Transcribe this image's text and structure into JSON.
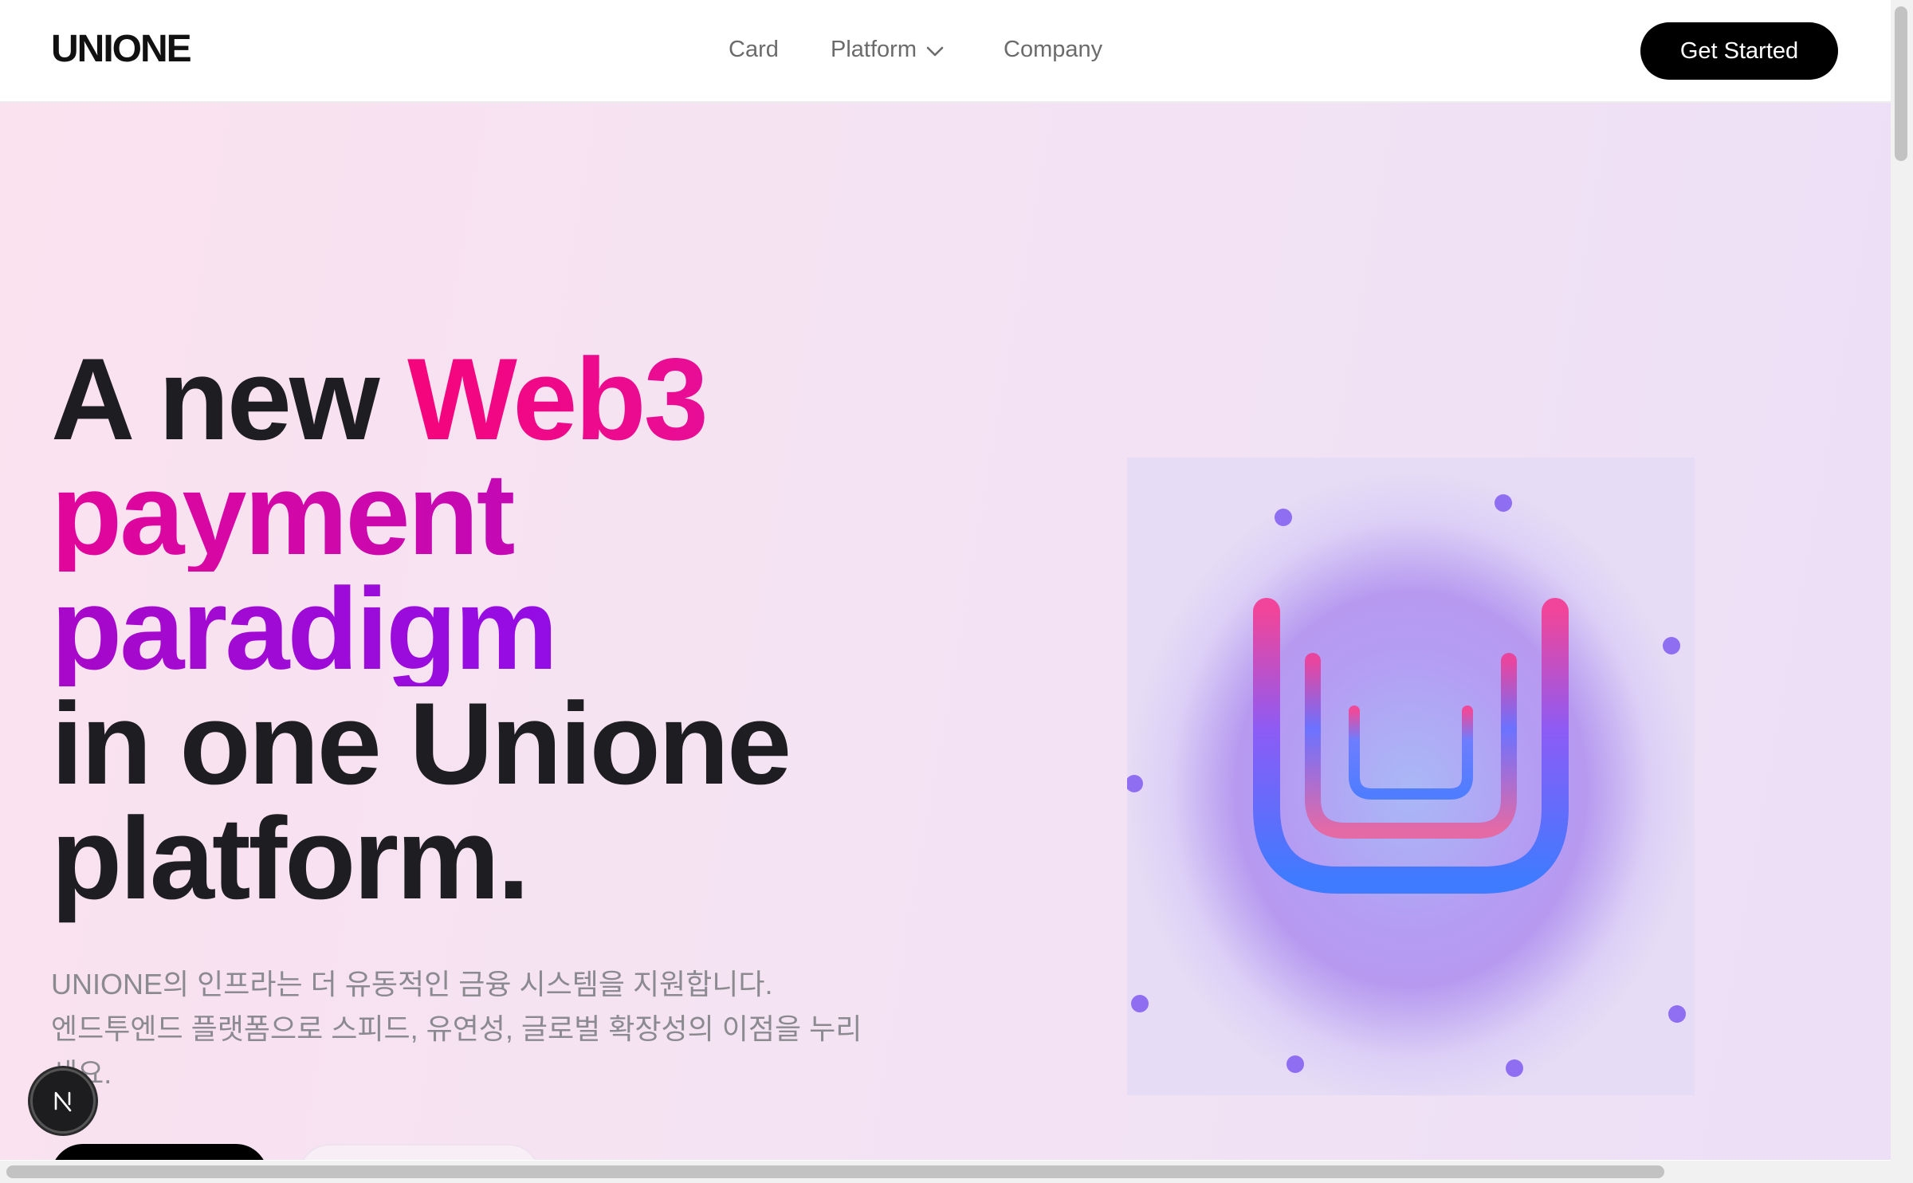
{
  "header": {
    "logo": "UNIONE",
    "nav": [
      {
        "label": "Card"
      },
      {
        "label": "Platform",
        "has_dropdown": true
      },
      {
        "label": "Company"
      }
    ],
    "cta_label": "Get Started"
  },
  "hero": {
    "headline": {
      "line1_plain": "A new ",
      "line1_accent": "Web3",
      "line2": "payment",
      "line3": "paradigm",
      "line4": "in one Unione",
      "line5": "platform."
    },
    "subtitle_line1": "UNIONE의 인프라는 더 유동적인 금융 시스템을 지원합니다.",
    "subtitle_line2": "엔드투엔드 플랫폼으로 스피드, 유연성, 글로벌 확장성의 이점을 누리",
    "subtitle_line3": "세요."
  },
  "art": {
    "icon": "unione-u-logo-icon",
    "colors": {
      "pink": "#f0459a",
      "purple": "#8b5cf6",
      "blue": "#3f7bff"
    }
  },
  "colors": {
    "accent_pink": "#f5047c",
    "accent_purple": "#8c0ff2",
    "text_dark": "#1e1e22",
    "text_muted": "#8a8a90",
    "button_dark": "#000000"
  },
  "overlay": {
    "next_badge_icon": "nextjs-icon",
    "badge_letter": "N"
  }
}
